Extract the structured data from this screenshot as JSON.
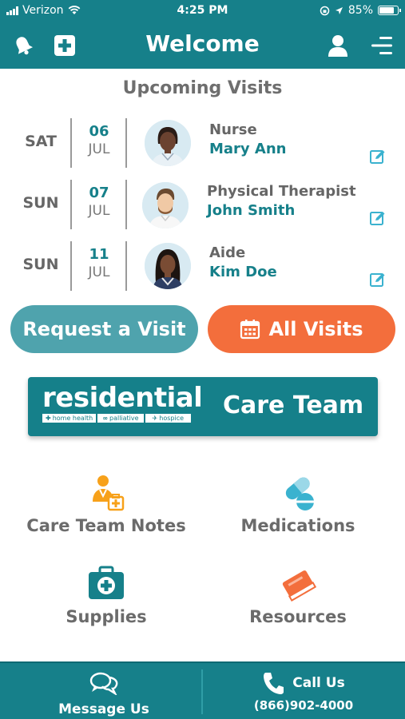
{
  "status_bar": {
    "carrier": "Verizon",
    "time": "4:25 PM",
    "battery": "85%",
    "battery_level": 0.85
  },
  "header": {
    "title": "Welcome",
    "left_icons": [
      "bell-icon",
      "add-icon"
    ],
    "right_icons": [
      "user-icon",
      "menu-icon"
    ]
  },
  "upcoming": {
    "title": "Upcoming Visits",
    "visits": [
      {
        "day": "SAT",
        "date": "06",
        "month": "JUL",
        "role": "Nurse",
        "name": "Mary Ann"
      },
      {
        "day": "SUN",
        "date": "07",
        "month": "JUL",
        "role": "Physical Therapist",
        "name": "John Smith"
      },
      {
        "day": "SUN",
        "date": "11",
        "month": "JUL",
        "role": "Aide",
        "name": "Kim Doe"
      }
    ]
  },
  "buttons": {
    "request_label": "Request a Visit",
    "all_visits_label": "All Visits"
  },
  "banner": {
    "logo_word": "residential",
    "tag_home": "home health",
    "tag_palliative": "palliative",
    "tag_hospice": "hospice",
    "care_team": "Care Team"
  },
  "grid": {
    "care_notes": "Care Team Notes",
    "medications": "Medications",
    "supplies": "Supplies",
    "resources": "Resources"
  },
  "footer": {
    "message_label": "Message Us",
    "call_label": "Call Us",
    "phone": "(866)902-4000"
  },
  "colors": {
    "teal": "#16808a",
    "teal_light": "#4fa3ad",
    "orange": "#f36e3c",
    "icon_orange": "#f7a11a",
    "icon_blue": "#3ab2cf"
  }
}
